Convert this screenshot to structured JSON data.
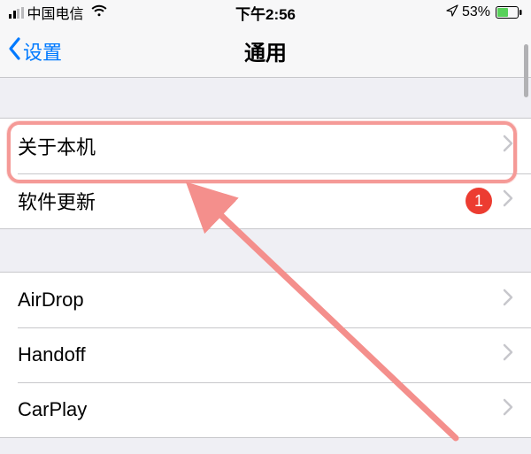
{
  "status": {
    "carrier": "中国电信",
    "time": "下午2:56",
    "battery_pct": "53%"
  },
  "nav": {
    "back_label": "设置",
    "title": "通用"
  },
  "group1": {
    "about": "关于本机",
    "software_update": "软件更新",
    "software_update_badge": "1"
  },
  "group2": {
    "airdrop": "AirDrop",
    "handoff": "Handoff",
    "carplay": "CarPlay"
  },
  "annotation": {
    "highlight_color": "#f59a97",
    "arrow_color": "#f48f8c"
  }
}
